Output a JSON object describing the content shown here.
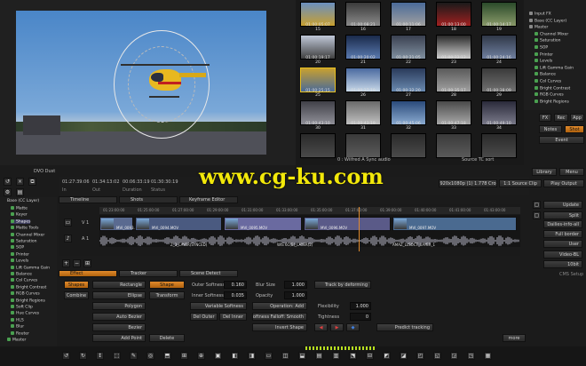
{
  "viewer": {
    "bottom_label": "DVO Dust"
  },
  "gallery": {
    "thumbs": [
      {
        "tc": "01:00:05:07",
        "n": "15"
      },
      {
        "tc": "01:00:08:21",
        "n": "16"
      },
      {
        "tc": "01:00:11:06",
        "n": "17"
      },
      {
        "tc": "01:00:13:00",
        "n": "18"
      },
      {
        "tc": "01:00:14:17",
        "n": "19"
      },
      {
        "tc": "01:00:19:17",
        "n": "20"
      },
      {
        "tc": "01:00:20:02",
        "n": "21"
      },
      {
        "tc": "01:00:21:05",
        "n": "22"
      },
      {
        "tc": "01:00:22:12",
        "n": "23"
      },
      {
        "tc": "01:00:24:16",
        "n": "24"
      },
      {
        "tc": "01:00:25:15",
        "n": "25"
      },
      {
        "tc": "01:00:27:19",
        "n": "26"
      },
      {
        "tc": "01:00:32:20",
        "n": "27"
      },
      {
        "tc": "01:00:35:17",
        "n": "28"
      },
      {
        "tc": "01:00:38:09",
        "n": "29"
      },
      {
        "tc": "01:00:43:10",
        "n": "30"
      },
      {
        "tc": "01:00:43:19",
        "n": "31"
      },
      {
        "tc": "01:00:45:06",
        "n": "32"
      },
      {
        "tc": "01:00:47:18",
        "n": "33"
      },
      {
        "tc": "01:00:49:10",
        "n": "34"
      },
      {
        "tc": "",
        "n": ""
      },
      {
        "tc": "",
        "n": ""
      },
      {
        "tc": "",
        "n": ""
      },
      {
        "tc": "",
        "n": ""
      },
      {
        "tc": "",
        "n": ""
      }
    ],
    "status_left": "0 : Wilfred A Sync audio",
    "status_right": "Source TC sort"
  },
  "nodes": {
    "items": [
      "Input FX",
      "Base (CC Layer)",
      "Master",
      "Channel Mixer",
      "Saturation",
      "SOP",
      "Printer",
      "Levels",
      "Lift Gamma Gain",
      "Balance",
      "Col Curves",
      "Bright Contrast",
      "RGB Curves",
      "Bright Regions"
    ],
    "buttons": {
      "fx": "FX",
      "rec": "Rec",
      "app": "App",
      "notes": "Notes",
      "shot": "Shot",
      "event": "Event",
      "library": "Library",
      "menu": "Menu",
      "play_output": "Play Output"
    }
  },
  "timecode_bar": {
    "tc1": "01:27:39:06",
    "tc2": "01:34:13:02",
    "tc3": "00:06:33:19",
    "tc4": "01:30:30:19",
    "in": "In",
    "out": "Out",
    "duration": "Duration",
    "status": "Status",
    "res": "1920x1080p (1) 1.778 Crop",
    "source_clip": "1:1 Source Clip"
  },
  "timeline_tabs": {
    "timeline": "Timeline",
    "shots": "Shots",
    "keyframe": "Keyframe Editor"
  },
  "tracks": {
    "v1": "V 1",
    "a1": "A 1"
  },
  "ruler": [
    "01:23:00:00",
    "01:25:00:00",
    "01:27:00:00",
    "01:29:00:00",
    "01:31:00:00",
    "01:33:00:00",
    "01:35:00:00",
    "01:37:00:00",
    "01:39:00:00",
    "01:40:00:00",
    "01:41:00:00",
    "01:43:00:00"
  ],
  "clips": [
    "MVI_0093.MOV",
    "MVI_0094.MOV",
    "MVI_0095.MOV",
    "MVI_0096.MOV",
    "MVI_0097.MOV"
  ],
  "audio_clips": [
    "Z_3_LAYER(SYNCED)",
    "WIS 6C(B)_LAYER(2)",
    "AMAZ_LLSOCT_LAYER_1"
  ],
  "left_tree": {
    "header": "Base (CC Layer)",
    "items": [
      "Matte",
      "Keyer",
      "Shapes",
      "Matte Tools",
      "Channel Mixer",
      "Saturation",
      "SOP",
      "Printer",
      "Levels",
      "Lift Gamma Gain",
      "Balance",
      "Col Curves",
      "Bright Contrast",
      "RGB Curves",
      "Bright Regions",
      "Soft Clip",
      "Hue Curves",
      "HLS",
      "Blur",
      "Router",
      "Master"
    ]
  },
  "effect_tabs": {
    "effect": "Effect",
    "tracker": "Tracker",
    "scene": "Scene Detect"
  },
  "shapes_panel": {
    "shapes": "Shapes",
    "combine": "Combine",
    "rectangle": "Rectangle",
    "ellipse": "Ellipse",
    "polygon": "Polygon",
    "auto_bezier": "Auto Bezier",
    "bezier": "Bezier",
    "add_point": "Add Point",
    "shape": "Shape",
    "transform": "Transform",
    "delete": "Delete"
  },
  "softness_panel": {
    "outer_label": "Outer Softness",
    "outer_value": "0.160",
    "inner_label": "Inner Softness",
    "inner_value": "0.035",
    "variable": "Variable Softness",
    "del_outer": "Del Outer",
    "del_inner": "Del Inner"
  },
  "blur_panel": {
    "blur_label": "Blur Size",
    "blur_value": "1.000",
    "opacity_label": "Opacity",
    "opacity_value": "1.000",
    "operation": "Operation: Add",
    "falloff": "Softness Falloff: Smooth",
    "invert": "Invert Shape"
  },
  "tracker_panel": {
    "track": "Track by deforming",
    "flexibility_label": "Flexibility",
    "flexibility_value": "1.000",
    "tightness_label": "Tightness",
    "tightness_value": "0",
    "predict": "Predict tracking"
  },
  "right_buttons": {
    "update": "Update",
    "split": "Split",
    "dailies": "Dailies-info-all",
    "full_border": "Full border",
    "user": "User",
    "video": "Video-BL",
    "bits": "10bit",
    "cms": "CMS Setup",
    "more": "more"
  },
  "watermark": "www.cg-ku.com",
  "colors": {
    "accent": "#e08a2c",
    "panel": "#232323",
    "sky": "#6a9ad0"
  }
}
